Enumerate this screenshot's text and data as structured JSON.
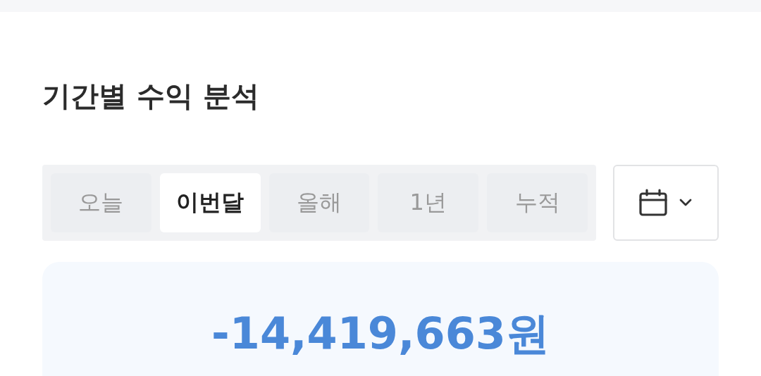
{
  "title": "기간별 수익 분석",
  "tabs": [
    {
      "label": "오늘",
      "selected": false
    },
    {
      "label": "이번달",
      "selected": true
    },
    {
      "label": "올해",
      "selected": false
    },
    {
      "label": "1년",
      "selected": false
    },
    {
      "label": "누적",
      "selected": false
    }
  ],
  "summary": {
    "amount": "-14,419,663원"
  }
}
